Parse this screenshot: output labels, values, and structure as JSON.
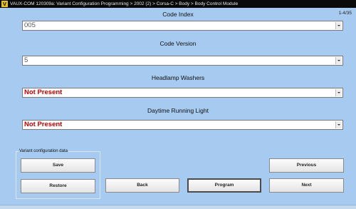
{
  "window": {
    "icon_letter": "V",
    "title": "VAUX-COM 120309a: Variant Configuration Programming > 2002 (2) > Corsa-C > Body > Body Control Module",
    "page_counter": "1-4/35"
  },
  "fields": [
    {
      "label": "Code Index",
      "value": "005"
    },
    {
      "label": "Code Version",
      "value": "5"
    },
    {
      "label": "Headlamp Washers",
      "value": "Not Present"
    },
    {
      "label": "Daytime Running Light",
      "value": "Not Present"
    }
  ],
  "variant_group": {
    "label": "Variant configuration data",
    "save_label": "Save",
    "restore_label": "Restore"
  },
  "navigation": {
    "back_label": "Back",
    "program_label": "Program",
    "previous_label": "Previous",
    "next_label": "Next"
  },
  "colors": {
    "background": "#a6caf0",
    "value_alert": "#c00000",
    "titlebar": "#0a0a0a"
  }
}
